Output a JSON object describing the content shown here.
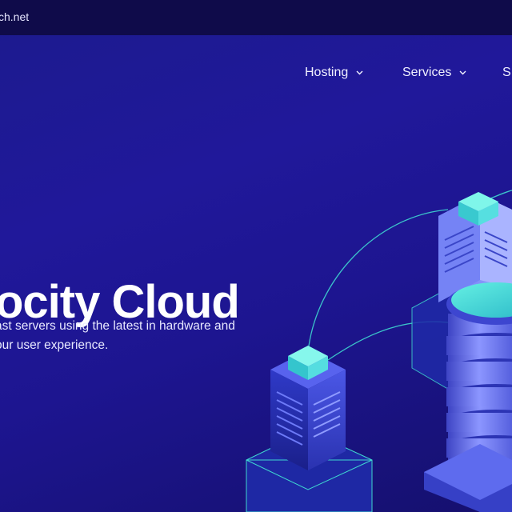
{
  "topbar": {
    "site_text": "ch.net"
  },
  "nav": {
    "items": [
      {
        "label": "Hosting"
      },
      {
        "label": "Services"
      },
      {
        "label": "S"
      }
    ]
  },
  "hero": {
    "title": "ocity Cloud",
    "subtitle_line1": "ast servers using the latest in hardware and",
    "subtitle_line2": "our user experience."
  },
  "colors": {
    "background": "#1f1896",
    "topbar": "#0f0b4a",
    "accent_teal": "#3fd6d0",
    "server_blue": "#4a55e0",
    "server_light": "#7f8cff"
  },
  "illustration": {
    "name": "isometric-servers-illustration"
  }
}
